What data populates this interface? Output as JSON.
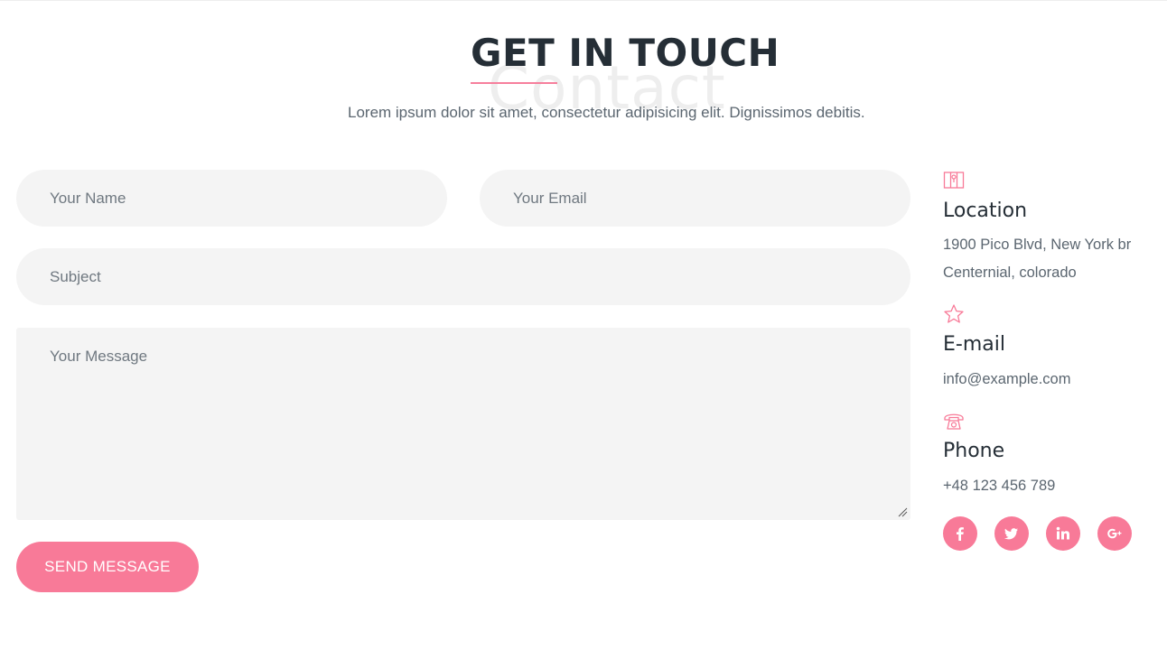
{
  "header": {
    "watermark": "Contact",
    "title": "GET IN TOUCH",
    "subtitle": "Lorem ipsum dolor sit amet, consectetur adipisicing elit. Dignissimos debitis."
  },
  "form": {
    "name_placeholder": "Your Name",
    "email_placeholder": "Your Email",
    "subject_placeholder": "Subject",
    "message_placeholder": "Your Message",
    "submit_label": "SEND MESSAGE"
  },
  "contact": {
    "location": {
      "icon": "map-icon",
      "title": "Location",
      "line1": "1900 Pico Blvd, New York br",
      "line2": "Centernial, colorado"
    },
    "email": {
      "icon": "star-icon",
      "title": "E-mail",
      "value": "info@example.com"
    },
    "phone": {
      "icon": "telephone-icon",
      "title": "Phone",
      "value": "+48 123 456 789"
    },
    "social": [
      {
        "name": "facebook-icon",
        "glyph": "f"
      },
      {
        "name": "twitter-icon",
        "glyph": ""
      },
      {
        "name": "linkedin-icon",
        "glyph": "in"
      },
      {
        "name": "google-plus-icon",
        "glyph": "G+"
      }
    ]
  },
  "colors": {
    "accent": "#f87a98",
    "heading": "#252e36",
    "text": "#5b6670",
    "field_bg": "#f4f4f4"
  }
}
